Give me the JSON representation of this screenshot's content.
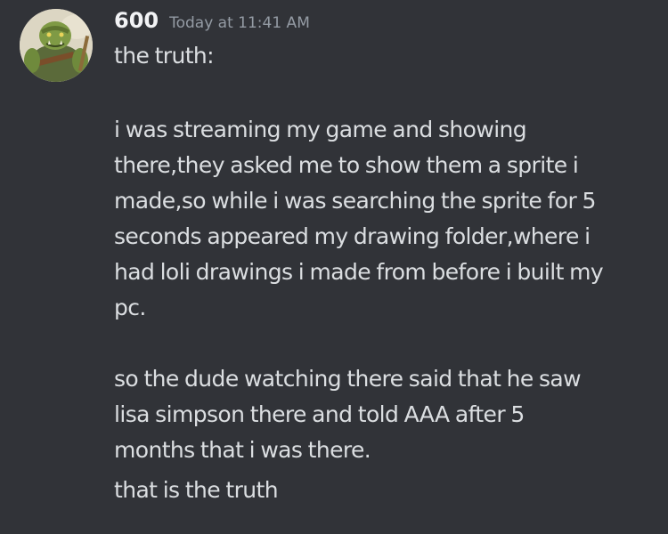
{
  "message": {
    "author": "600",
    "timestamp": "Today at 11:41 AM",
    "avatar_icon": "ogre-warrior-avatar",
    "lines": {
      "p1": [
        "the truth:"
      ],
      "p2": [
        "i was streaming my game and showing",
        "there,they asked me to show them a sprite i",
        "made,so while i was searching the sprite for 5",
        "seconds appeared my drawing folder,where i",
        "had loli drawings i made from before i built my",
        "pc."
      ],
      "p3": [
        "so the dude watching there said that he saw",
        "lisa simpson there and told AAA after 5",
        "months that i was there."
      ],
      "p4": [
        "that is the truth"
      ]
    }
  },
  "colors": {
    "background": "#313338",
    "username": "#f2f3f5",
    "timestamp": "#949ba4",
    "text": "#dbdee1"
  }
}
